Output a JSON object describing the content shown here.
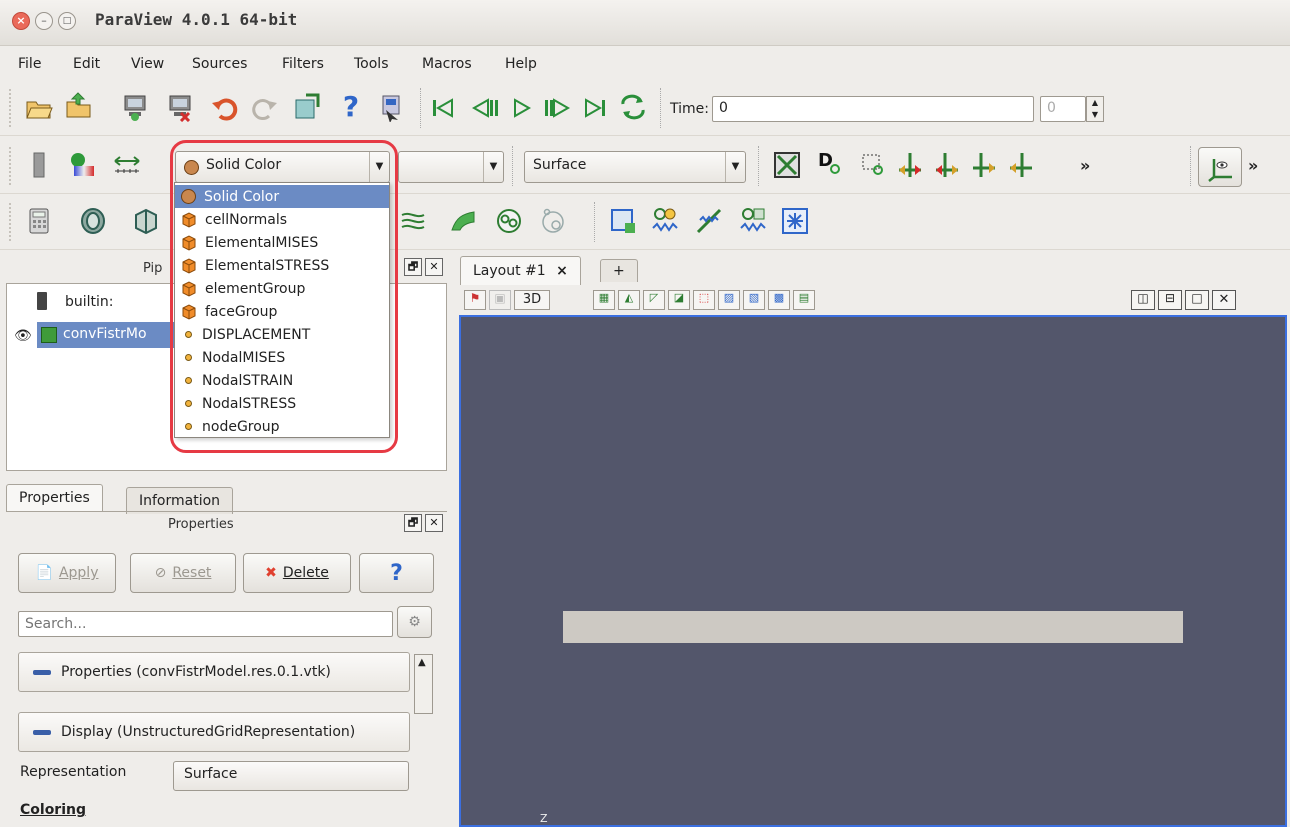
{
  "window": {
    "title": "ParaView 4.0.1 64-bit",
    "close": "×",
    "min": "–",
    "max": "□"
  },
  "menu": [
    "File",
    "Edit",
    "View",
    "Sources",
    "Filters",
    "Tools",
    "Macros",
    "Help"
  ],
  "toolbar": {
    "time_label": "Time:",
    "time_value": "0",
    "time_index": "0",
    "more": "»",
    "coloring_selected": "Solid Color",
    "component_combo": "",
    "representation_combo": "Surface"
  },
  "pipeline": {
    "title": "Pipeline Browser",
    "title_visible": "Pip",
    "items": [
      "builtin:",
      "convFistrModel.res.0.1.vtk"
    ],
    "items_visible": [
      "builtin:",
      "convFistrMo"
    ]
  },
  "tabs": {
    "properties": "Properties",
    "information": "Information"
  },
  "properties": {
    "title": "Properties",
    "apply": "Apply",
    "reset": "Reset",
    "delete": "Delete",
    "help": "?",
    "search_placeholder": "Search...",
    "section_properties": "Properties (convFistrModel.res.0.1.vtk)",
    "section_display": "Display (UnstructuredGridRepresentation)",
    "representation_label": "Representation",
    "representation_value": "Surface",
    "coloring_label": "Coloring"
  },
  "layout": {
    "tab": "Layout #1",
    "close": "×",
    "add": "+",
    "btn_3d": "3D"
  },
  "color_list": [
    {
      "label": "Solid Color",
      "kind": "solid",
      "selected": true
    },
    {
      "label": "cellNormals",
      "kind": "cell"
    },
    {
      "label": "ElementalMISES",
      "kind": "cell"
    },
    {
      "label": "ElementalSTRESS",
      "kind": "cell"
    },
    {
      "label": "elementGroup",
      "kind": "cell"
    },
    {
      "label": "faceGroup",
      "kind": "cell"
    },
    {
      "label": "DISPLACEMENT",
      "kind": "point"
    },
    {
      "label": "NodalMISES",
      "kind": "point"
    },
    {
      "label": "NodalSTRAIN",
      "kind": "point"
    },
    {
      "label": "NodalSTRESS",
      "kind": "point"
    },
    {
      "label": "nodeGroup",
      "kind": "point"
    }
  ],
  "axis_label": "Z",
  "colors": {
    "viewport_bg": "#53566b",
    "highlight": "#e63a44",
    "selection": "#6b8bc4"
  }
}
